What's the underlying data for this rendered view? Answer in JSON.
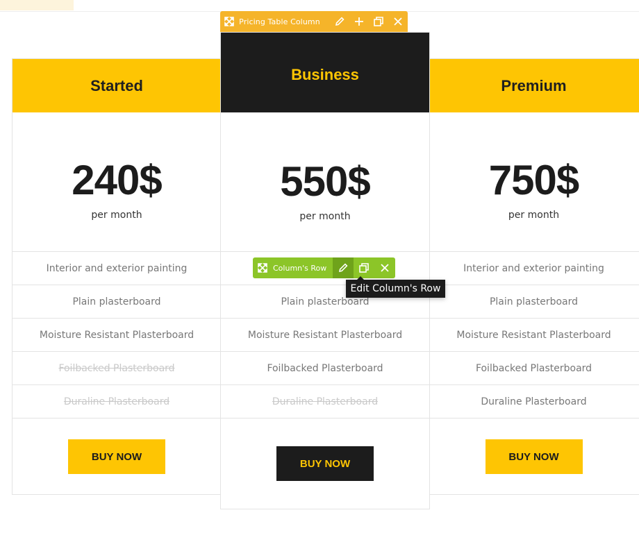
{
  "editor": {
    "column_toolbar": {
      "title": "Pricing Table Column",
      "color": "#f5b42a"
    },
    "row_toolbar": {
      "title": "Column's Row",
      "color": "#8cc528"
    },
    "tooltip": "Edit Column's Row"
  },
  "plans": [
    {
      "name": "Started",
      "price": "240$",
      "period": "per month",
      "features": [
        "Interior and exterior painting",
        "Plain plasterboard",
        "Moisture Resistant Plasterboard",
        "Foilbacked Plasterboard",
        "Duraline Plasterboard"
      ],
      "feature_available": [
        true,
        true,
        true,
        false,
        false
      ],
      "button": "BUY NOW"
    },
    {
      "name": "Business",
      "price": "550$",
      "period": "per month",
      "features": [
        "",
        "Plain plasterboard",
        "Moisture Resistant Plasterboard",
        "Foilbacked Plasterboard",
        "Duraline Plasterboard"
      ],
      "feature_available": [
        true,
        true,
        true,
        true,
        false
      ],
      "button": "BUY NOW"
    },
    {
      "name": "Premium",
      "price": "750$",
      "period": "per month",
      "features": [
        "Interior and exterior painting",
        "Plain plasterboard",
        "Moisture Resistant Plasterboard",
        "Foilbacked Plasterboard",
        "Duraline Plasterboard"
      ],
      "feature_available": [
        true,
        true,
        true,
        true,
        true
      ],
      "button": "BUY NOW"
    }
  ],
  "colors": {
    "accent": "#fec503",
    "dark": "#1c1c1c",
    "muted_text": "#777777",
    "strike_text": "#c9c9c9"
  }
}
